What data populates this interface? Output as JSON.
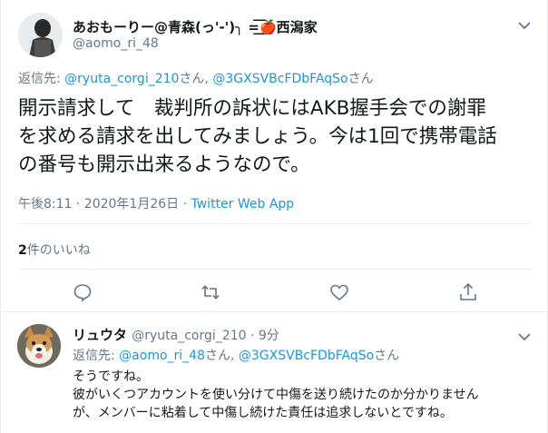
{
  "tweet": {
    "display_name": "あおもーりー@青森(っ'-')╮ =͟͟͞͞🍎西潟家",
    "handle": "@aomo_ri_48",
    "replying_label": "返信先: ",
    "replying_user1": "@ryuta_corgi_210",
    "replying_san1": "さん, ",
    "replying_user2": "@3GXSVBcFDbFAqSo",
    "replying_san2": "さん",
    "text_lines": [
      "開示請求して　裁判所の訴状にはAKB握手会での謝罪",
      "を求める請求を出してみましょう。今は1回で携帯電話",
      "の番号も開示出来るようなので。"
    ],
    "time": "午後8:11 · 2020年1月26日 · ",
    "source": "Twitter Web App",
    "like_count": "2",
    "like_label": "件のいいね"
  },
  "reply": {
    "display_name": "リュウタ",
    "handle_time": "@ryuta_corgi_210 · 9分",
    "replying_label": "返信先: ",
    "replying_user1": "@aomo_ri_48",
    "replying_san1": "さん, ",
    "replying_user2": "@3GXSVBcFDbFAqSo",
    "replying_san2": "さん",
    "text_lines": [
      "そうですね。",
      "彼がいくつアカウントを使い分けて中傷を送り続けたのか分かりません",
      "が、メンバーに粘着して中傷し続けた責任は追求しないとですね。"
    ]
  },
  "icons": [
    "chevron-down-icon",
    "reply-icon",
    "retweet-icon",
    "like-icon",
    "share-icon"
  ],
  "colors": {
    "link": "#1b95e0",
    "muted": "#657786",
    "text": "#14171a",
    "divider": "#e6ecf0"
  }
}
